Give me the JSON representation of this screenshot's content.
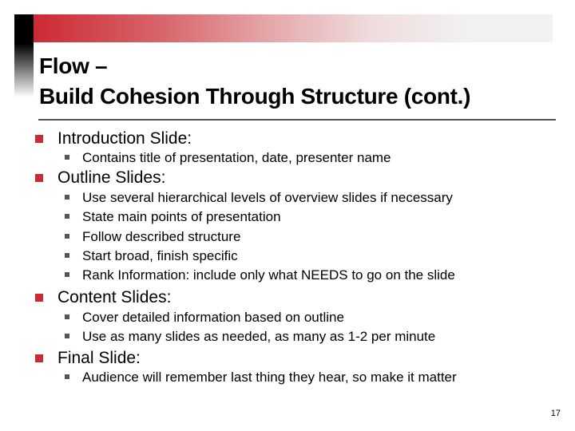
{
  "slide": {
    "title_line1": "Flow –",
    "title_line2": "Build Cohesion Through Structure (cont.)",
    "page_number": "17",
    "colors": {
      "accent": "#cc2a33",
      "sub_bullet": "#555555",
      "divider": "#555555"
    },
    "sections": [
      {
        "heading": "Introduction Slide:",
        "items": [
          "Contains title of presentation, date, presenter name"
        ]
      },
      {
        "heading": "Outline Slides:",
        "items": [
          "Use several hierarchical levels of overview slides if necessary",
          "State main points of presentation",
          "Follow described structure",
          "Start broad, finish specific",
          "Rank Information: include only what NEEDS to go on the slide"
        ]
      },
      {
        "heading": "Content Slides:",
        "items": [
          "Cover detailed information based on outline",
          "Use as many slides as needed, as many as 1-2 per minute"
        ]
      },
      {
        "heading": "Final Slide:",
        "items": [
          "Audience will remember last thing they hear, so make it matter"
        ]
      }
    ]
  }
}
